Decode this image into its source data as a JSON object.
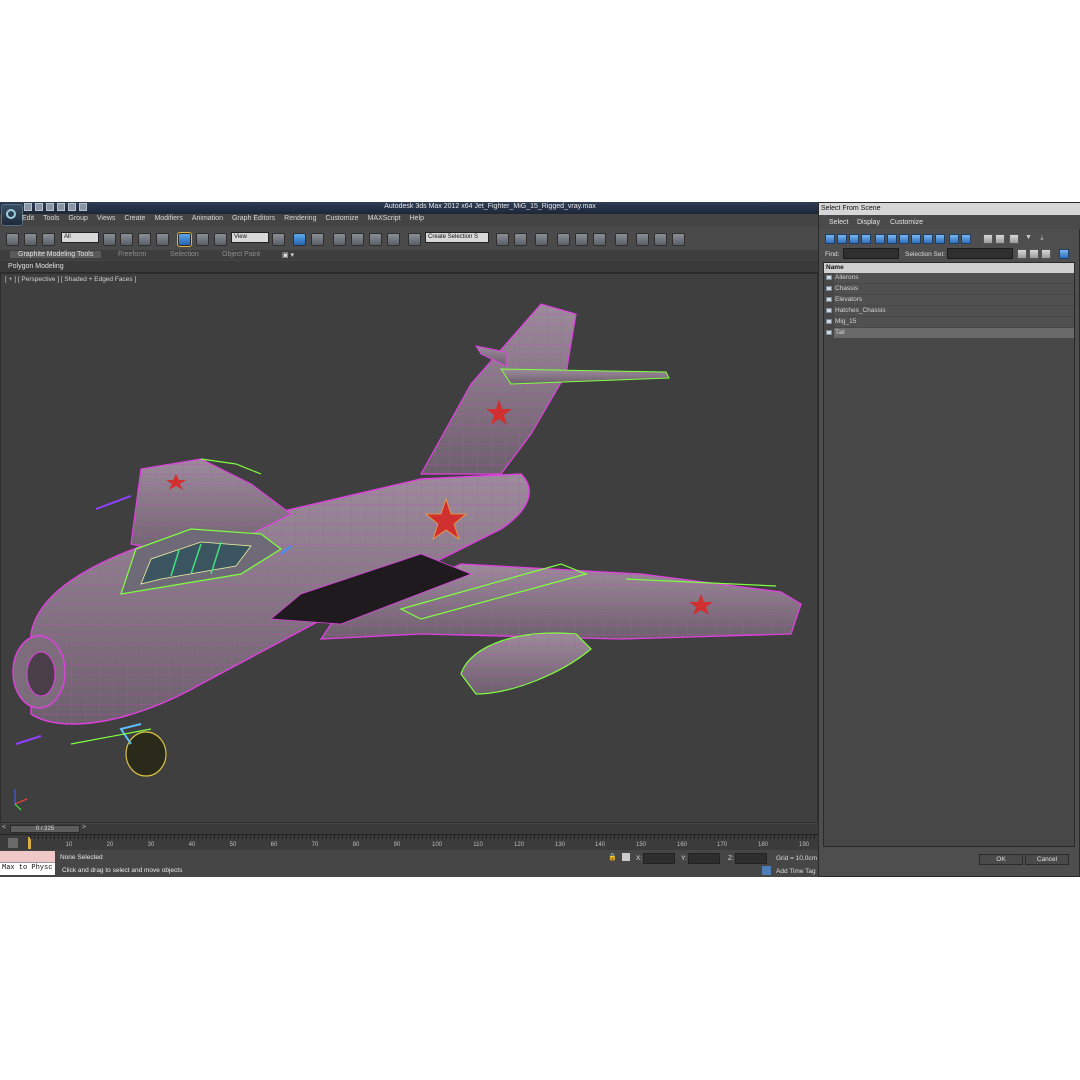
{
  "window": {
    "title": "Autodesk 3ds Max  2012 x64      Jet_Fighter_MiG_15_Rigged_vray.max"
  },
  "menu": [
    "Edit",
    "Tools",
    "Group",
    "Views",
    "Create",
    "Modifiers",
    "Animation",
    "Graph Editors",
    "Rendering",
    "Customize",
    "MAXScript",
    "Help"
  ],
  "toolbar": {
    "filter_value": "All",
    "refcoord_value": "View",
    "selection_set_value": "Create Selection S"
  },
  "ribbon": {
    "tabs": [
      "Graphite Modeling Tools",
      "Freeform",
      "Selection",
      "Object Paint"
    ],
    "panel_label": "Polygon Modeling"
  },
  "viewport": {
    "label": "[ + ] [ Perspective ] [ Shaded + Edged Faces ]"
  },
  "timeline": {
    "slider_text": "0 / 225",
    "ticks": [
      "10",
      "20",
      "30",
      "40",
      "50",
      "60",
      "70",
      "80",
      "90",
      "100",
      "110",
      "120",
      "130",
      "140",
      "150",
      "160",
      "170",
      "180",
      "190"
    ]
  },
  "status": {
    "maxscript_text": "Max to Physc",
    "selection": "None Selected",
    "prompt": "Click and drag to select and move objects",
    "x_label": "X:",
    "y_label": "Y:",
    "z_label": "Z:",
    "grid": "Grid = 10,0cm",
    "add_time_tag": "Add Time Tag"
  },
  "dialog": {
    "title": "Select From Scene",
    "menu": [
      "Select",
      "Display",
      "Customize"
    ],
    "find_label": "Find:",
    "selection_set_label": "Selection Set:",
    "column_name": "Name",
    "items": [
      "Ailerons",
      "Chassis",
      "Elevators",
      "Hatches_Chassis",
      "Mig_15",
      "Tail"
    ],
    "ok": "OK",
    "cancel": "Cancel"
  },
  "colors": {
    "viewport_bg": "#3f3f3f",
    "model_wire": "#e040e0",
    "selection_wire": "#80ff40",
    "model_body": "#8c7a8a",
    "star": "#d03030"
  }
}
